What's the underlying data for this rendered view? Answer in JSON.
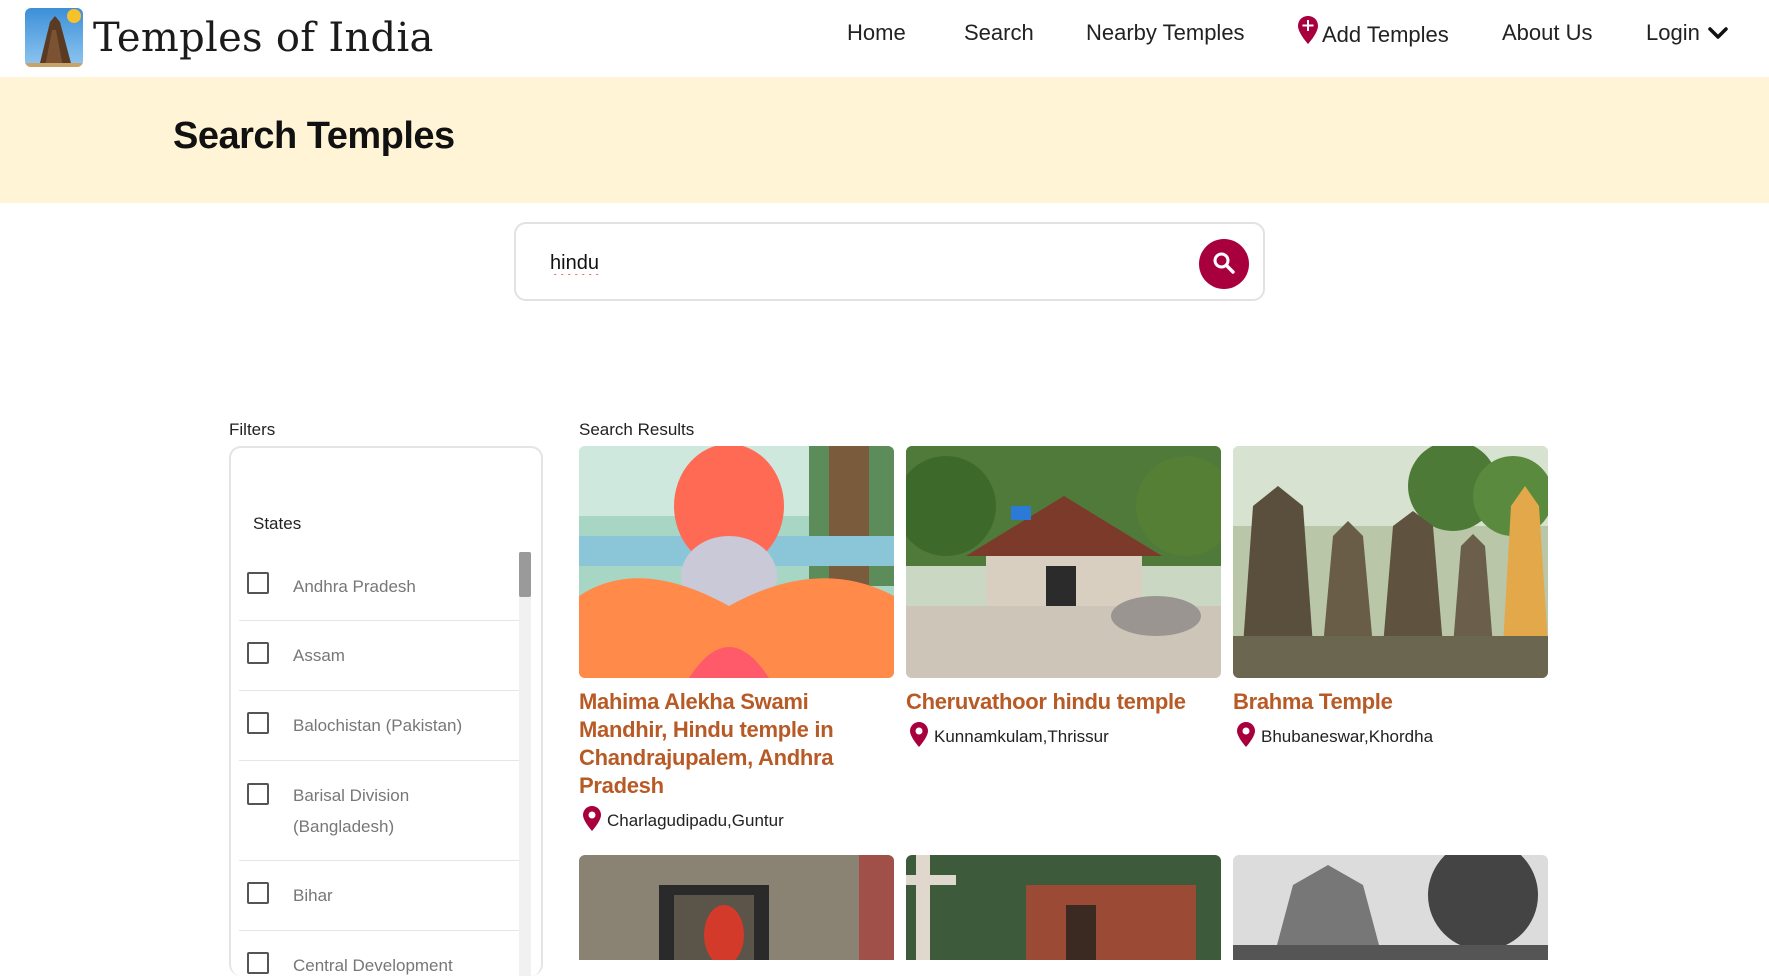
{
  "header": {
    "brand": "Temples of India",
    "nav": [
      {
        "label": "Home"
      },
      {
        "label": "Search"
      },
      {
        "label": "Nearby Temples"
      },
      {
        "label": "Add Temples"
      },
      {
        "label": "About Us"
      },
      {
        "label": "Login"
      }
    ]
  },
  "hero": {
    "title": "Search Temples"
  },
  "search": {
    "value": "hindu"
  },
  "filters": {
    "label": "Filters",
    "states_heading": "States",
    "states": [
      "Andhra Pradesh",
      "Assam",
      "Balochistan (Pakistan)",
      "Barisal Division (Bangladesh)",
      "Bihar",
      "Central Development"
    ]
  },
  "results": {
    "label": "Search Results",
    "items": [
      {
        "title": "Mahima Alekha Swami Mandhir, Hindu temple in Chandrajupalem, Andhra Pradesh",
        "location": "Charlagudipadu,Guntur"
      },
      {
        "title": "Cheruvathoor hindu temple",
        "location": "Kunnamkulam,Thrissur"
      },
      {
        "title": "Brahma Temple",
        "location": "Bhubaneswar,Khordha"
      }
    ]
  },
  "colors": {
    "accent": "#a8003c",
    "hero_bg": "#fff4d6",
    "result_title": "#b85a26"
  }
}
